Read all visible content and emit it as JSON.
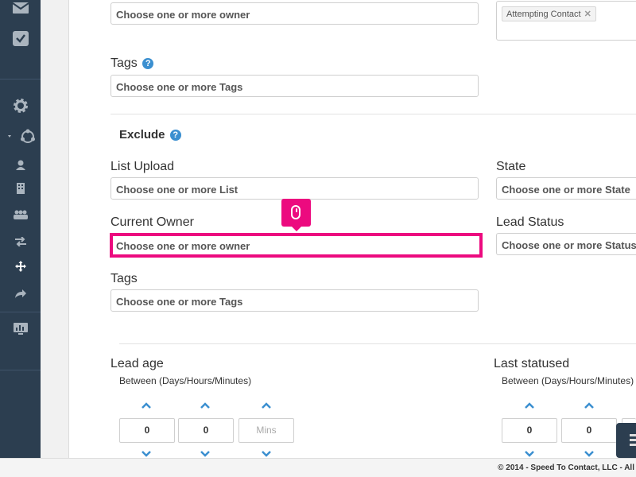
{
  "include": {
    "owner_placeholder": "Choose one or more owner",
    "tags_label": "Tags",
    "tags_placeholder": "Choose one or more Tags",
    "status_tag": "Attempting Contact",
    "status_tag_remove": "✕"
  },
  "exclude": {
    "title": "Exclude",
    "help": "?",
    "list_upload_label": "List Upload",
    "list_upload_placeholder": "Choose one or more List",
    "state_label": "State",
    "state_placeholder": "Choose one or more State",
    "current_owner_label": "Current Owner",
    "current_owner_placeholder": "Choose one or more owner",
    "lead_status_label": "Lead Status",
    "lead_status_placeholder": "Choose one or more Status",
    "tags_label": "Tags",
    "tags_placeholder": "Choose one or more Tags"
  },
  "lead_age": {
    "label": "Lead age",
    "between": "Between (Days/Hours/Minutes)",
    "days": "0",
    "hours": "0",
    "minutes_placeholder": "Mins"
  },
  "last_statused": {
    "label": "Last statused",
    "between": "Between (Days/Hours/Minutes)",
    "days": "0",
    "hours": "0"
  },
  "footer": {
    "text": "© 2014 - Speed To Contact, LLC - All"
  },
  "colors": {
    "sidebar": "#2c3e50",
    "highlight": "#ec0a7f",
    "accent": "#3b8fd0"
  },
  "icons": [
    "mail-icon",
    "task-icon",
    "gear-icon",
    "share-icon",
    "user-icon",
    "building-icon",
    "group-icon",
    "transfer-icon",
    "move-icon",
    "forward-icon",
    "monitor-icon",
    "mouse-icon",
    "menu-icon"
  ]
}
